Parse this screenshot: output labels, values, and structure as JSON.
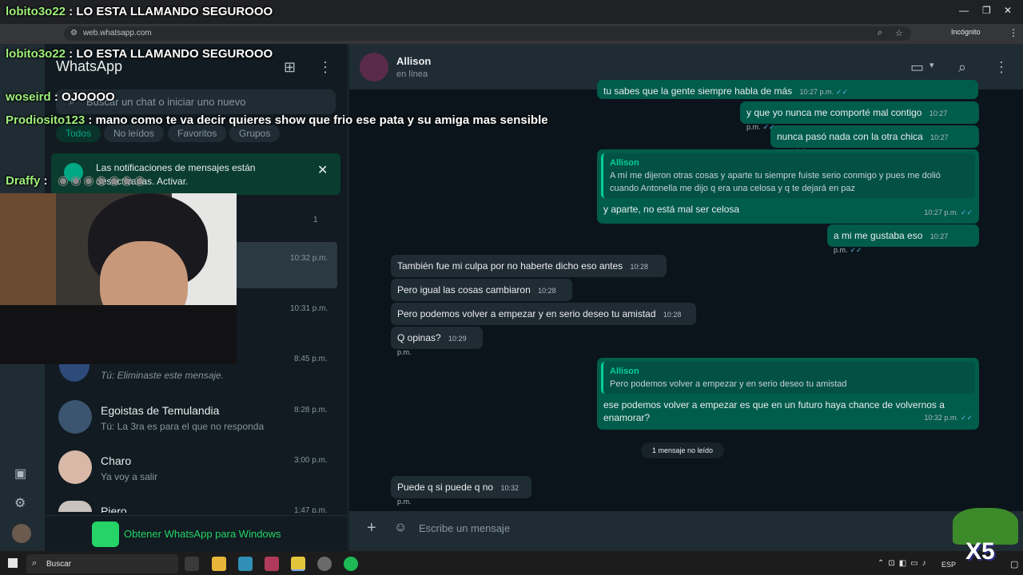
{
  "browser": {
    "url": "web.whatsapp.com",
    "incognito_label": "Incógnito"
  },
  "left_header": {
    "title": "WhatsApp"
  },
  "search": {
    "placeholder": "Buscar un chat o iniciar uno nuevo"
  },
  "filters": [
    "Todos",
    "No leídos",
    "Favoritos",
    "Grupos"
  ],
  "notification": {
    "text": "Las notificaciones de mensajes están desactivadas. Activar."
  },
  "chats": [
    {
      "name": "",
      "last": "",
      "time": "",
      "badge": "1"
    },
    {
      "name": "",
      "last": "",
      "time": "10:32 p.m."
    },
    {
      "name": "",
      "last": "",
      "time": "10:31 p.m."
    },
    {
      "name": "",
      "last": "Tú: Eliminaste este mensaje.",
      "time": "8:45 p.m."
    },
    {
      "name": "Egoistas de Temulandia",
      "last": "Tú: La 3ra es para el que no responda",
      "time": "8:28 p.m."
    },
    {
      "name": "Charo",
      "last": "Ya voy a salir",
      "time": "3:00 p.m."
    },
    {
      "name": "Piero",
      "last": "",
      "time": "1:47 p.m."
    }
  ],
  "get_whatsapp": {
    "label": "Obtener WhatsApp para Windows"
  },
  "contact": {
    "name": "Allison",
    "status": "en línea"
  },
  "messages": [
    {
      "dir": "out",
      "text": "tu sabes que la gente siempre habla de más",
      "time": "10:27 p.m."
    },
    {
      "dir": "out",
      "text": "y que yo nunca me comporté mal contigo",
      "time": "10:27 p.m."
    },
    {
      "dir": "out",
      "text": "nunca pasó nada con la otra chica",
      "time": "10:27 p.m."
    },
    {
      "dir": "out",
      "quote_name": "Allison",
      "quote_text": "A mí me dijeron otras cosas y aparte tu siempre fuiste serio conmigo y pues me dolió cuando Antonella me dijo q era una celosa y q te dejará en paz",
      "text": "y aparte, no está mal ser celosa",
      "time": "10:27 p.m."
    },
    {
      "dir": "out",
      "text": "a mi me gustaba eso",
      "time": "10:27 p.m."
    },
    {
      "dir": "in",
      "text": "También fue mi culpa por no haberte dicho eso antes",
      "time": "10:28 p.m."
    },
    {
      "dir": "in",
      "text": "Pero igual las cosas cambiaron",
      "time": "10:28 p.m."
    },
    {
      "dir": "in",
      "text": "Pero podemos volver a empezar y en serio deseo tu amistad",
      "time": "10:28 p.m."
    },
    {
      "dir": "in",
      "text": "Q opinas?",
      "time": "10:29 p.m."
    },
    {
      "dir": "out",
      "quote_name": "Allison",
      "quote_text": "Pero podemos volver a empezar y en serio deseo tu amistad",
      "text": "ese podemos volver a empezar es que en un futuro haya chance de volvernos a enamorar?",
      "time": "10:32 p.m."
    },
    {
      "dir": "in",
      "text": "Puede q si puede q no",
      "time": "10:32 p.m."
    }
  ],
  "unread_label": "1 mensaje no leído",
  "composer": {
    "placeholder": "Escribe un mensaje"
  },
  "taskbar": {
    "search_label": "Buscar",
    "lang": "ESP"
  },
  "stream_chat": [
    {
      "user": "lobito3o22",
      "text": "LO ESTA LLAMANDO SEGUROOO"
    },
    {
      "user": "lobito3o22",
      "text": "LO ESTA LLAMANDO SEGUROOO"
    },
    {
      "user": "woseird",
      "text": "OJOOOO"
    },
    {
      "user": "Prodiosito123",
      "text": "mano como te va decir quieres show que frio ese pata y su amiga mas sensible"
    },
    {
      "user": "Draffy",
      "text": ""
    }
  ],
  "overlay_badge": "X5",
  "colors": {
    "outgoing_bubble": "#005c4b",
    "incoming_bubble": "#202c33",
    "accent": "#00a884",
    "background": "#0b141a"
  }
}
